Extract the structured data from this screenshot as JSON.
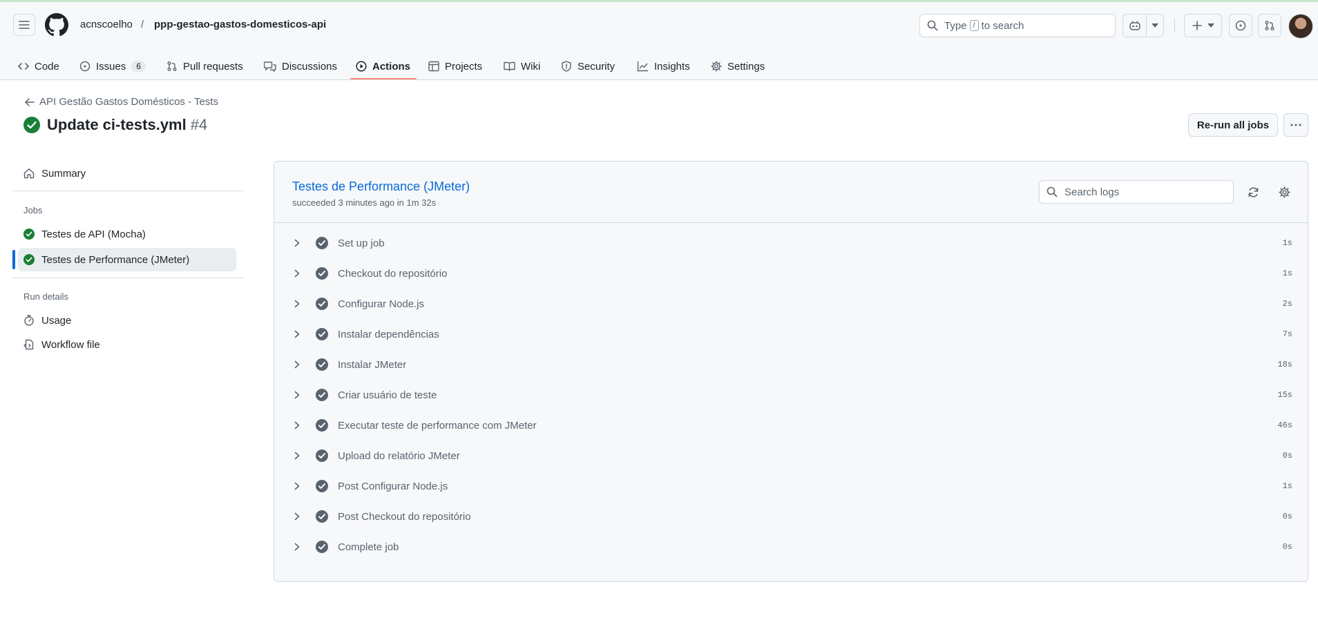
{
  "repo": {
    "owner": "acnscoelho",
    "separator": "/",
    "name": "ppp-gestao-gastos-domesticos-api"
  },
  "search": {
    "prefix": "Type",
    "key": "/",
    "suffix": "to search"
  },
  "tabs": [
    {
      "label": "Code",
      "icon": "code-icon"
    },
    {
      "label": "Issues",
      "icon": "issue-opened-icon",
      "count": "6"
    },
    {
      "label": "Pull requests",
      "icon": "git-pull-request-icon"
    },
    {
      "label": "Discussions",
      "icon": "comment-discussion-icon"
    },
    {
      "label": "Actions",
      "icon": "play-icon",
      "active": true
    },
    {
      "label": "Projects",
      "icon": "table-icon"
    },
    {
      "label": "Wiki",
      "icon": "book-icon"
    },
    {
      "label": "Security",
      "icon": "shield-icon"
    },
    {
      "label": "Insights",
      "icon": "graph-icon"
    },
    {
      "label": "Settings",
      "icon": "gear-icon"
    }
  ],
  "run": {
    "workflow_name": "API Gestão Gastos Domésticos - Tests",
    "title": "Update ci-tests.yml",
    "number": "#4",
    "rerun_label": "Re-run all jobs"
  },
  "sidebar": {
    "summary_label": "Summary",
    "jobs_heading": "Jobs",
    "jobs": [
      {
        "label": "Testes de API (Mocha)",
        "selected": false
      },
      {
        "label": "Testes de Performance (JMeter)",
        "selected": true
      }
    ],
    "run_details_heading": "Run details",
    "usage_label": "Usage",
    "workflow_file_label": "Workflow file"
  },
  "job": {
    "title": "Testes de Performance (JMeter)",
    "status_line": "succeeded 3 minutes ago in 1m 32s",
    "search_placeholder": "Search logs",
    "steps": [
      {
        "name": "Set up job",
        "duration": "1s"
      },
      {
        "name": "Checkout do repositório",
        "duration": "1s"
      },
      {
        "name": "Configurar Node.js",
        "duration": "2s"
      },
      {
        "name": "Instalar dependências",
        "duration": "7s"
      },
      {
        "name": "Instalar JMeter",
        "duration": "18s"
      },
      {
        "name": "Criar usuário de teste",
        "duration": "15s"
      },
      {
        "name": "Executar teste de performance com JMeter",
        "duration": "46s"
      },
      {
        "name": "Upload do relatório JMeter",
        "duration": "0s"
      },
      {
        "name": "Post Configurar Node.js",
        "duration": "1s"
      },
      {
        "name": "Post Checkout do repositório",
        "duration": "0s"
      },
      {
        "name": "Complete job",
        "duration": "0s"
      }
    ]
  },
  "colors": {
    "success": "#1a7f37",
    "link": "#0969da",
    "tab_underline": "#fd8c73",
    "step_check": "#59636e"
  }
}
